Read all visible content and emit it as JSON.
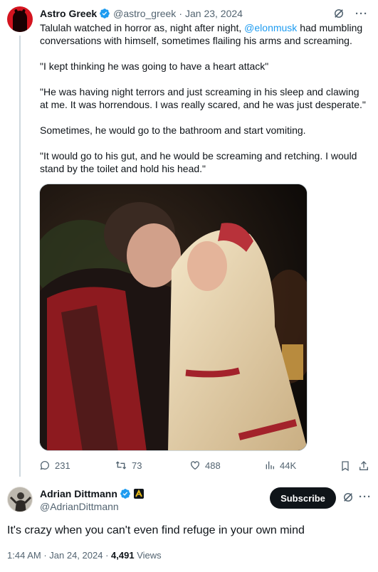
{
  "quoted_tweet": {
    "author_name": "Astro Greek",
    "author_handle": "@astro_greek",
    "separator": "·",
    "date": "Jan 23, 2024",
    "text": {
      "p1_before": "Talulah watched in horror as, night after night, ",
      "p1_mention": "@elonmusk",
      "p1_after": " had mumbling conversations with himself, sometimes flailing his arms and screaming.",
      "p2": "\"I kept thinking he was going to have a heart attack\"",
      "p3": "\"He was having night terrors and just screaming in his sleep and clawing at me. It was horrendous. I was really scared, and he was just desperate.\"",
      "p4": "Sometimes, he would go to the bathroom and start vomiting.",
      "p5": "\"It would go to his gut, and he would be screaming and retching. I would stand by the toilet and hold his head.\""
    },
    "stats": {
      "replies": "231",
      "reposts": "73",
      "likes": "488",
      "views": "44K"
    }
  },
  "main_tweet": {
    "author_name": "Adrian Dittmann",
    "author_handle": "@AdrianDittmann",
    "subscribe_label": "Subscribe",
    "text": "It's crazy when you can't even find refuge in your own mind",
    "time": "1:44 AM",
    "date": "Jan 24, 2024",
    "views_count": "4,491",
    "views_label": "Views",
    "dot": " · "
  },
  "colors": {
    "accent": "#1d9bf0",
    "text": "#0f1419",
    "muted": "#536471",
    "badge_gold": "#e2b719"
  },
  "icons": [
    "verified-badge-icon",
    "grok-icon",
    "more-icon",
    "reply-icon",
    "repost-icon",
    "like-icon",
    "views-icon",
    "bookmark-icon",
    "share-icon",
    "affiliate-badge-icon"
  ]
}
